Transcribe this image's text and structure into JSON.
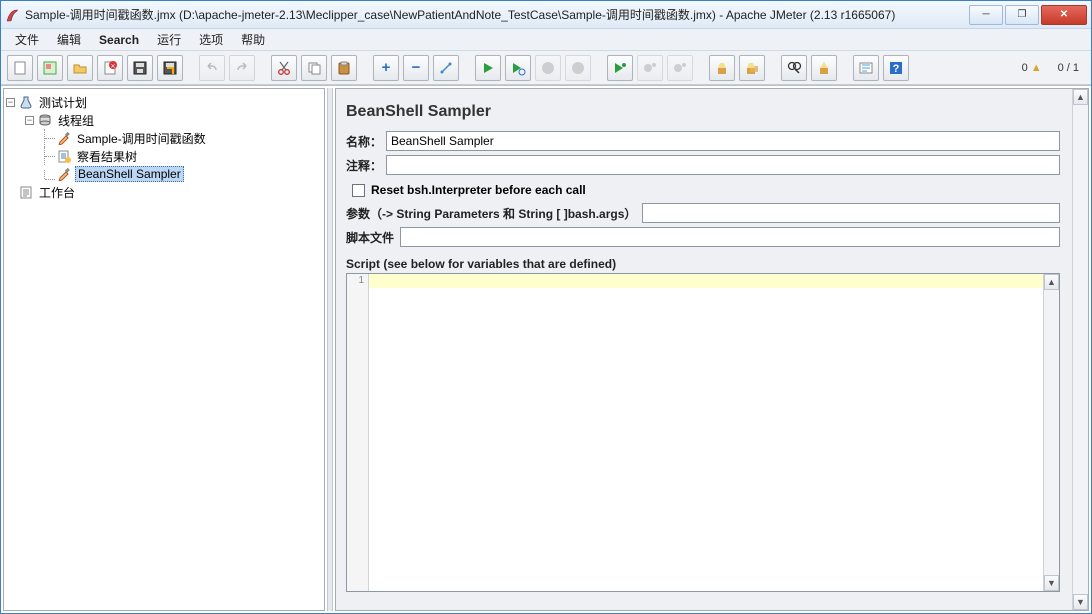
{
  "window": {
    "title": "Sample-调用时间戳函数.jmx (D:\\apache-jmeter-2.13\\Meclipper_case\\NewPatientAndNote_TestCase\\Sample-调用时间戳函数.jmx) - Apache JMeter (2.13 r1665067)"
  },
  "menu": {
    "file": "文件",
    "edit": "编辑",
    "search": "Search",
    "run": "运行",
    "options": "选项",
    "help": "帮助"
  },
  "status": {
    "warn_count": "0",
    "thread_count": "0 / 1"
  },
  "tree": {
    "plan": "测试计划",
    "threadgroup": "线程组",
    "sampler1": "Sample-调用时间戳函数",
    "viewtree": "察看结果树",
    "beanshell": "BeanShell Sampler",
    "workbench": "工作台"
  },
  "editor": {
    "title": "BeanShell Sampler",
    "name_label": "名称：",
    "name_value": "BeanShell Sampler",
    "comment_label": "注释：",
    "comment_value": "",
    "reset_label": "Reset bsh.Interpreter before each call",
    "params_label": "参数（-> String Parameters 和 String [ ]bash.args）",
    "params_value": "",
    "scriptfile_label": "脚本文件",
    "scriptfile_value": "",
    "script_label": "Script (see below for variables that are defined)"
  }
}
